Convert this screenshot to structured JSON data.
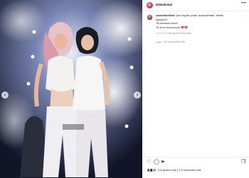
{
  "post": {
    "author": "lalimalomat",
    "more_icon": "more-horizontal-icon"
  },
  "comment": {
    "username": "cazzudeoficial",
    "line1": "Que orgullo poder acompañarte, brillás",
    "line2": "siempre!!",
    "line3": "Te mereces todo!!",
    "line4": "Te amo muchooooo",
    "hearts": "❤️❤️",
    "meta": "1 h   72.122 Me gusta   Responder",
    "replies": "Ver respuestas (86)"
  },
  "actions": {
    "like": "♡",
    "comment": "◯",
    "share": "➤",
    "save": "❐"
  },
  "likes": {
    "text": "Les gusta a lali y 1 M personas más"
  },
  "navigation": {
    "prev": "‹",
    "next": "›"
  }
}
